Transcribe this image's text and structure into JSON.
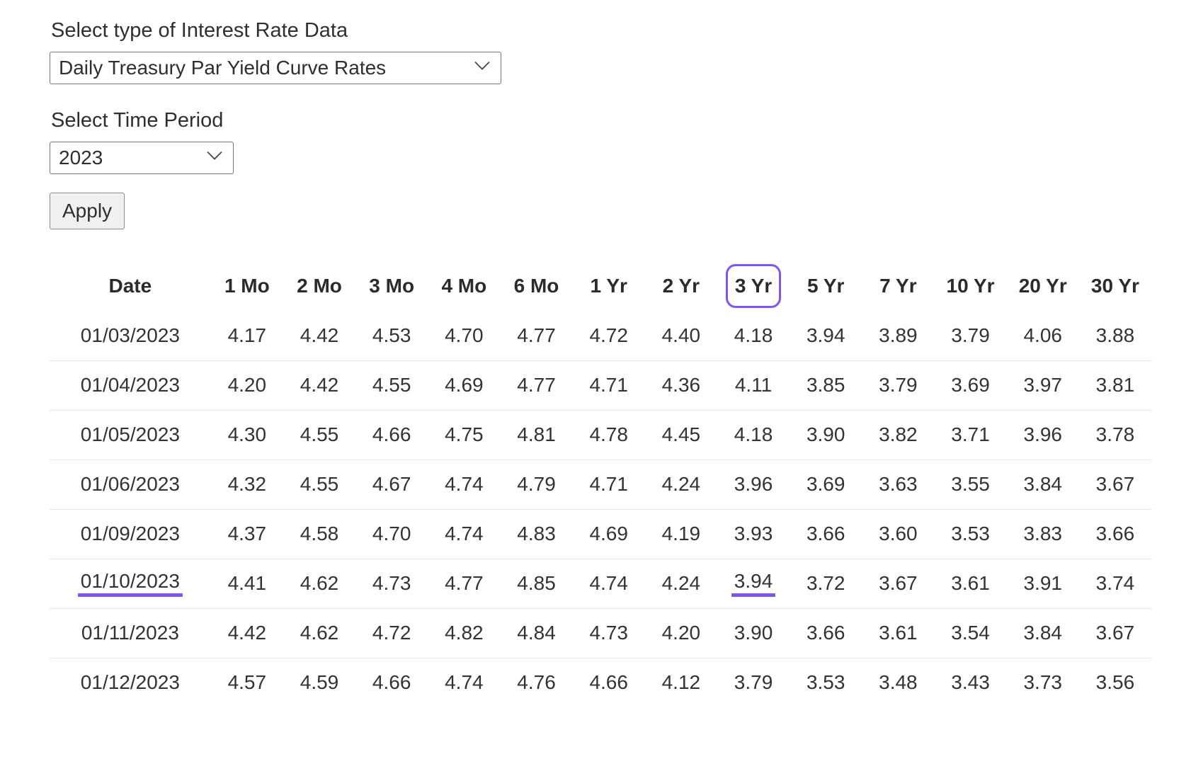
{
  "form": {
    "type_label": "Select type of Interest Rate Data",
    "type_value": "Daily Treasury Par Yield Curve Rates",
    "period_label": "Select Time Period",
    "period_value": "2023",
    "apply_label": "Apply"
  },
  "highlight": {
    "color": "#7d55f2",
    "column": "3 Yr",
    "row_date": "01/10/2023",
    "cell_value": "3.94"
  },
  "table": {
    "columns": [
      "Date",
      "1 Mo",
      "2 Mo",
      "3 Mo",
      "4 Mo",
      "6 Mo",
      "1 Yr",
      "2 Yr",
      "3 Yr",
      "5 Yr",
      "7 Yr",
      "10 Yr",
      "20 Yr",
      "30 Yr"
    ],
    "rows": [
      [
        "01/03/2023",
        "4.17",
        "4.42",
        "4.53",
        "4.70",
        "4.77",
        "4.72",
        "4.40",
        "4.18",
        "3.94",
        "3.89",
        "3.79",
        "4.06",
        "3.88"
      ],
      [
        "01/04/2023",
        "4.20",
        "4.42",
        "4.55",
        "4.69",
        "4.77",
        "4.71",
        "4.36",
        "4.11",
        "3.85",
        "3.79",
        "3.69",
        "3.97",
        "3.81"
      ],
      [
        "01/05/2023",
        "4.30",
        "4.55",
        "4.66",
        "4.75",
        "4.81",
        "4.78",
        "4.45",
        "4.18",
        "3.90",
        "3.82",
        "3.71",
        "3.96",
        "3.78"
      ],
      [
        "01/06/2023",
        "4.32",
        "4.55",
        "4.67",
        "4.74",
        "4.79",
        "4.71",
        "4.24",
        "3.96",
        "3.69",
        "3.63",
        "3.55",
        "3.84",
        "3.67"
      ],
      [
        "01/09/2023",
        "4.37",
        "4.58",
        "4.70",
        "4.74",
        "4.83",
        "4.69",
        "4.19",
        "3.93",
        "3.66",
        "3.60",
        "3.53",
        "3.83",
        "3.66"
      ],
      [
        "01/10/2023",
        "4.41",
        "4.62",
        "4.73",
        "4.77",
        "4.85",
        "4.74",
        "4.24",
        "3.94",
        "3.72",
        "3.67",
        "3.61",
        "3.91",
        "3.74"
      ],
      [
        "01/11/2023",
        "4.42",
        "4.62",
        "4.72",
        "4.82",
        "4.84",
        "4.73",
        "4.20",
        "3.90",
        "3.66",
        "3.61",
        "3.54",
        "3.84",
        "3.67"
      ],
      [
        "01/12/2023",
        "4.57",
        "4.59",
        "4.66",
        "4.74",
        "4.76",
        "4.66",
        "4.12",
        "3.79",
        "3.53",
        "3.48",
        "3.43",
        "3.73",
        "3.56"
      ]
    ]
  },
  "icons": {
    "dropdown": "chevron-down-icon"
  }
}
